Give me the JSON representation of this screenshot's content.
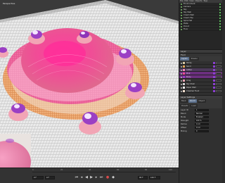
{
  "viewport": {
    "camera_label": "Perspective"
  },
  "timeline": {
    "ticks": [
      "0",
      "20",
      "40",
      "60",
      "80",
      "100"
    ],
    "start_frame": "0 F",
    "current_frame": "0 F",
    "end_frame": "90 F",
    "max_frame": "100 F"
  },
  "objects": {
    "menu": [
      "File",
      "Edit",
      "View",
      "Objects",
      "Tags"
    ],
    "items": [
      "Environment",
      "Camera",
      "Sky",
      "Sky Wall",
      "Cream Wall",
      "Cream Top",
      "Spire Hat",
      "Plate",
      "Donut",
      "Floor"
    ]
  },
  "layers": {
    "section_title": "Layer",
    "title": "Fluid",
    "tabs": [
      "Layers",
      "Shader"
    ],
    "rows": [
      "Sticky",
      "Sand",
      "Glitter",
      "Pink",
      "Body",
      "Icing",
      "Sky Shell",
      "Paper Wall",
      "Creamer Fund"
    ],
    "accent_color": "#8b3fcf"
  },
  "attributes": {
    "section_title": "Layer Settings",
    "tabs": [
      "Basic",
      "Coord",
      "Object"
    ],
    "subtabs": [
      "Presets",
      "Load"
    ],
    "props": [
      {
        "label": "Layer ID",
        "value": "1"
      },
      {
        "label": "Blend",
        "value": "Normal"
      },
      {
        "label": "Mode",
        "value": "Enabled"
      },
      {
        "label": "Strength",
        "value": "100 %"
      },
      {
        "label": "Radius",
        "value": "4 cm"
      },
      {
        "label": "Offset",
        "value": "0 cm"
      },
      {
        "label": "Mixing",
        "value": "0"
      }
    ]
  }
}
